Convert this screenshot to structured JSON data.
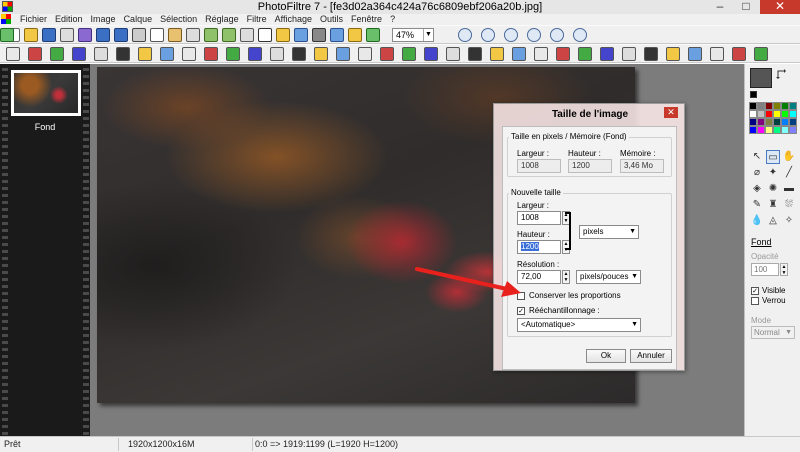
{
  "window": {
    "title": "PhotoFiltre 7 - [fe3d02a364c424a76c6809ebf206a20b.jpg]",
    "minimize": "–",
    "maximize": "□",
    "close": "✕"
  },
  "menu": [
    "Fichier",
    "Edition",
    "Image",
    "Calque",
    "Sélection",
    "Réglage",
    "Filtre",
    "Affichage",
    "Outils",
    "Fenêtre",
    "?"
  ],
  "toolbar": {
    "zoom_value": "47%",
    "zoom_arrow": "▼"
  },
  "layers_panel": {
    "layer_name": "Fond"
  },
  "dialog": {
    "title": "Taille de l'image",
    "close": "✕",
    "current_group": "Taille en pixels / Mémoire (Fond)",
    "current_width_label": "Largeur :",
    "current_height_label": "Hauteur :",
    "current_memory_label": "Mémoire :",
    "current_width": "1008",
    "current_height": "1200",
    "current_memory": "3,46 Mo",
    "new_group": "Nouvelle taille",
    "new_width_label": "Largeur :",
    "new_width": "1008",
    "new_height_label": "Hauteur :",
    "new_height": "1200",
    "unit": "pixels",
    "resolution_label": "Résolution :",
    "resolution": "72,00",
    "resolution_unit": "pixels/pouces",
    "keep_proportions": "Conserver les proportions",
    "keep_proportions_checked": false,
    "resampling": "Rééchantillonnage :",
    "resampling_checked": true,
    "resampling_method": "<Automatique>",
    "ok": "Ok",
    "cancel": "Annuler",
    "spin_up": "▲",
    "spin_down": "▼",
    "dropdown_arrow": "▼",
    "check_mark": "✓"
  },
  "right_panel": {
    "layer_name": "Fond",
    "opacity_label": "Opacité",
    "opacity_value": "100",
    "visible_label": "Visible",
    "visible_checked": true,
    "lock_label": "Verrou",
    "lock_checked": false,
    "mode_label": "Mode",
    "mode_value": "Normal",
    "check_mark": "✓",
    "spin_up": "▲",
    "spin_down": "▼",
    "dropdown_arrow": "▼",
    "palette": [
      "#000000",
      "#808080",
      "#800000",
      "#808000",
      "#008000",
      "#008080",
      "#ffffff",
      "#c0c0c0",
      "#ff0000",
      "#ffff00",
      "#00ff00",
      "#00ffff",
      "#000080",
      "#800080",
      "#808040",
      "#004040",
      "#0080ff",
      "#004080",
      "#0000ff",
      "#ff00ff",
      "#ffff80",
      "#00ff80",
      "#80ffff",
      "#8080ff"
    ],
    "tool_icons": [
      "arrow-select-icon",
      "rect-select-icon",
      "hand-icon",
      "pipette-icon",
      "magic-wand-icon",
      "line-icon",
      "fill-icon",
      "spray-icon",
      "eraser-icon",
      "brush-icon",
      "stamp-icon",
      "clone-icon",
      "drop-icon",
      "blur-icon",
      "smudge-icon"
    ],
    "tool_glyphs": [
      "↖",
      "▭",
      "✋",
      "⌀",
      "✦",
      "╱",
      "◈",
      "✺",
      "▬",
      "✎",
      "♜",
      "⛆",
      "💧",
      "◬",
      "✧"
    ]
  },
  "status": {
    "ready": "Prêt",
    "dims": "1920x1200x16M",
    "coords": "0:0 => 1919:1199 (L=1920  H=1200)"
  },
  "colors": {
    "accent": "#3a6fd8",
    "close_red": "#c7392b",
    "annotation_arrow": "#e8211c"
  }
}
